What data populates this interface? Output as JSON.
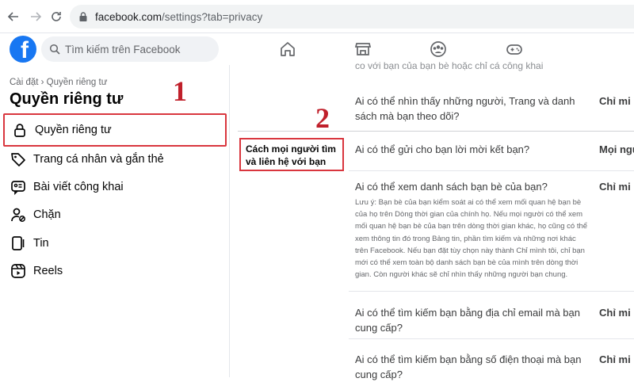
{
  "browser": {
    "url_host": "facebook.com",
    "url_path": "/settings?tab=privacy"
  },
  "header": {
    "logo_letter": "f",
    "search_placeholder": "Tìm kiếm trên Facebook",
    "nav_icons": [
      "home-icon",
      "marketplace-icon",
      "groups-icon",
      "gaming-icon"
    ]
  },
  "sidebar": {
    "breadcrumb": "Cài đặt › Quyền riêng tư",
    "title": "Quyền riêng tư",
    "items": [
      {
        "label": "Quyền riêng tư",
        "icon": "lock-icon"
      },
      {
        "label": "Trang cá nhân và gắn thẻ",
        "icon": "tag-icon"
      },
      {
        "label": "Bài viết công khai",
        "icon": "public-post-icon"
      },
      {
        "label": "Chặn",
        "icon": "block-user-icon"
      },
      {
        "label": "Tin",
        "icon": "stories-icon"
      },
      {
        "label": "Reels",
        "icon": "reels-icon"
      }
    ]
  },
  "annotations": {
    "one": "1",
    "two": "2"
  },
  "section": {
    "label": "Cách mọi người tìm và liên hệ với bạn"
  },
  "content": {
    "partial_top": "co với bạn của bạn bè hoặc chỉ cá công khai",
    "rows": [
      {
        "question": "Ai có thể nhìn thấy những người, Trang và danh sách mà bạn theo dõi?",
        "value": "Chỉ mi"
      },
      {
        "question": "Ai có thể gửi cho bạn lời mời kết bạn?",
        "value": "Mọi ngu"
      },
      {
        "question": "Ai có thể xem danh sách bạn bè của bạn?",
        "value": "Chỉ mi",
        "note": "Lưu ý: Bạn bè của bạn kiểm soát ai có thể xem mối quan hệ bạn bè của họ trên Dòng thời gian của chính họ. Nếu mọi người có thể xem mối quan hệ bạn bè của bạn trên dòng thời gian khác, họ cũng có thể xem thông tin đó trong Bảng tin, phần tìm kiếm và những nơi khác trên Facebook. Nếu bạn đặt tùy chọn này thành Chỉ mình tôi, chỉ bạn mới có thể xem toàn bộ danh sách bạn bè của mình trên dòng thời gian. Còn người khác sẽ chỉ nhìn thấy những người bạn chung."
      },
      {
        "question": "Ai có thể tìm kiếm bạn bằng địa chỉ email mà bạn cung cấp?",
        "value": "Chỉ mi"
      },
      {
        "question": "Ai có thể tìm kiếm bạn bằng số điện thoại mà bạn cung cấp?",
        "value": "Chỉ mi"
      }
    ]
  },
  "colors": {
    "accent": "#1877f2",
    "annotation_red": "#c0202b"
  }
}
